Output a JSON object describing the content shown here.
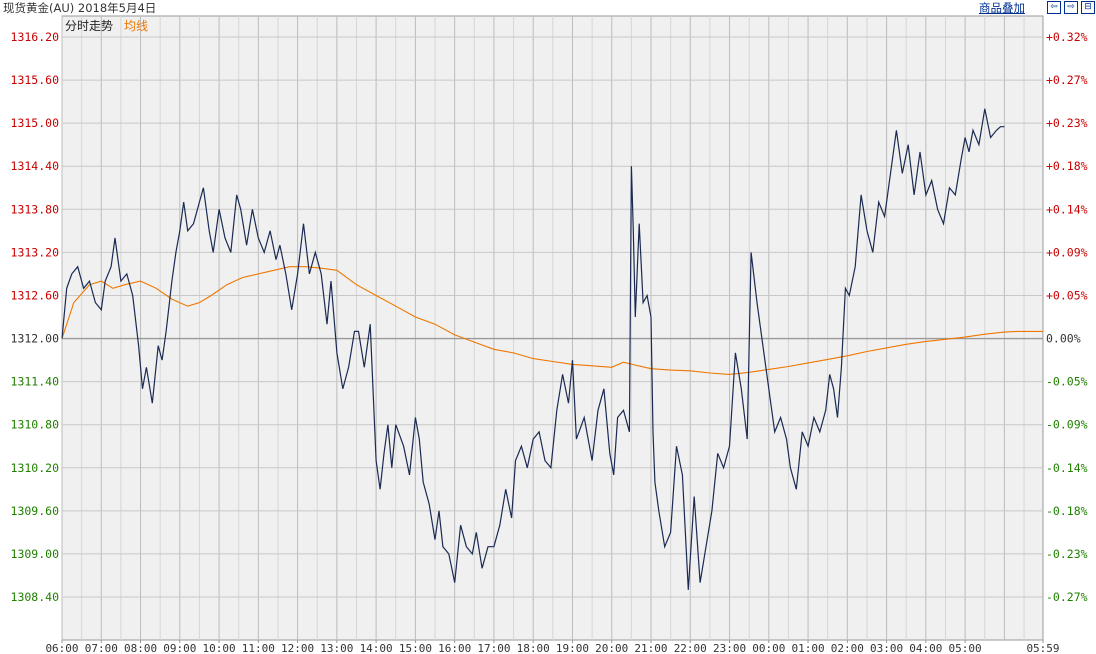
{
  "header": {
    "title": "现货黄金(AU) 2018年5月4日",
    "overlay_link": "商品叠加",
    "buttons": [
      {
        "name": "zoom-left-button",
        "glyph": "⇦"
      },
      {
        "name": "zoom-right-button",
        "glyph": "⇨"
      },
      {
        "name": "layout-button",
        "glyph": "⊟"
      }
    ]
  },
  "colors": {
    "background": "#f0f0f0",
    "grid": "#c8c8c8",
    "price_line": "#1a2a52",
    "avg_line": "#ee7700",
    "up": "#c80000",
    "down": "#208000",
    "neutral": "#333333"
  },
  "chart_data": {
    "type": "line",
    "legend": [
      "分时走势",
      "均线"
    ],
    "reference_price": 1312.0,
    "ylim": [
      1308.0,
      1316.3
    ],
    "y_ticks": [
      "1316.20",
      "1315.60",
      "1315.00",
      "1314.40",
      "1313.80",
      "1313.20",
      "1312.60",
      "1312.00",
      "1311.40",
      "1310.80",
      "1310.20",
      "1309.60",
      "1309.00",
      "1308.40"
    ],
    "right_ticks": [
      "+0.32%",
      "+0.27%",
      "+0.23%",
      "+0.18%",
      "+0.14%",
      "+0.09%",
      "+0.05%",
      "0.00%",
      "-0.05%",
      "-0.09%",
      "-0.14%",
      "-0.18%",
      "-0.23%",
      "-0.27%"
    ],
    "x_ticks": [
      "06:00",
      "07:00",
      "08:00",
      "09:00",
      "10:00",
      "11:00",
      "12:00",
      "13:00",
      "14:00",
      "15:00",
      "16:00",
      "17:00",
      "18:00",
      "19:00",
      "20:00",
      "21:00",
      "22:00",
      "23:00",
      "00:00",
      "01:00",
      "02:00",
      "03:00",
      "04:00",
      "05:00",
      "05:59"
    ],
    "series": [
      {
        "name": "分时走势",
        "x_hours": [
          0,
          0.12,
          0.25,
          0.4,
          0.55,
          0.7,
          0.85,
          1.0,
          1.1,
          1.25,
          1.35,
          1.5,
          1.65,
          1.8,
          1.95,
          2.05,
          2.15,
          2.3,
          2.45,
          2.55,
          2.65,
          2.8,
          2.9,
          3.0,
          3.1,
          3.2,
          3.35,
          3.5,
          3.6,
          3.75,
          3.85,
          4.0,
          4.15,
          4.3,
          4.45,
          4.55,
          4.7,
          4.85,
          5.0,
          5.15,
          5.3,
          5.45,
          5.55,
          5.7,
          5.85,
          6.0,
          6.15,
          6.3,
          6.45,
          6.6,
          6.75,
          6.85,
          7.0,
          7.15,
          7.3,
          7.45,
          7.55,
          7.7,
          7.85,
          8.0,
          8.1,
          8.2,
          8.3,
          8.4,
          8.5,
          8.7,
          8.85,
          9.0,
          9.1,
          9.2,
          9.35,
          9.5,
          9.6,
          9.7,
          9.85,
          10.0,
          10.15,
          10.3,
          10.45,
          10.55,
          10.7,
          10.85,
          11.0,
          11.15,
          11.3,
          11.45,
          11.55,
          11.7,
          11.85,
          12.0,
          12.15,
          12.3,
          12.45,
          12.6,
          12.75,
          12.9,
          13.0,
          13.1,
          13.3,
          13.5,
          13.65,
          13.8,
          13.95,
          14.05,
          14.15,
          14.3,
          14.45,
          14.5,
          14.55,
          14.6,
          14.7,
          14.8,
          14.9,
          15.0,
          15.05,
          15.1,
          15.2,
          15.35,
          15.5,
          15.65,
          15.8,
          15.95,
          16.1,
          16.25,
          16.4,
          16.55,
          16.7,
          16.85,
          17.0,
          17.15,
          17.3,
          17.45,
          17.55,
          17.7,
          17.85,
          18.0,
          18.15,
          18.3,
          18.45,
          18.55,
          18.7,
          18.85,
          19.0,
          19.15,
          19.3,
          19.45,
          19.55,
          19.65,
          19.75,
          19.85,
          19.95,
          20.05,
          20.2,
          20.35,
          20.5,
          20.65,
          20.8,
          20.95,
          21.1,
          21.25,
          21.4,
          21.55,
          21.7,
          21.85,
          22.0,
          22.15,
          22.3,
          22.45,
          22.6,
          22.75,
          22.9,
          23.0,
          23.1,
          23.2,
          23.35,
          23.5,
          23.65,
          23.8,
          23.9,
          24.0,
          24.05,
          24.1,
          24.15,
          24.98
        ],
        "values": [
          1312.0,
          1312.7,
          1312.9,
          1313.0,
          1312.7,
          1312.8,
          1312.5,
          1312.4,
          1312.8,
          1313.0,
          1313.4,
          1312.8,
          1312.9,
          1312.6,
          1311.9,
          1311.3,
          1311.6,
          1311.1,
          1311.9,
          1311.7,
          1312.1,
          1312.8,
          1313.2,
          1313.5,
          1313.9,
          1313.5,
          1313.6,
          1313.9,
          1314.1,
          1313.5,
          1313.2,
          1313.8,
          1313.4,
          1313.2,
          1314.0,
          1313.8,
          1313.3,
          1313.8,
          1313.4,
          1313.2,
          1313.5,
          1313.1,
          1313.3,
          1312.9,
          1312.4,
          1312.9,
          1313.6,
          1312.9,
          1313.2,
          1312.9,
          1312.2,
          1312.8,
          1311.8,
          1311.3,
          1311.6,
          1312.1,
          1312.1,
          1311.6,
          1312.2,
          1310.3,
          1309.9,
          1310.4,
          1310.8,
          1310.2,
          1310.8,
          1310.5,
          1310.1,
          1310.9,
          1310.6,
          1310.0,
          1309.7,
          1309.2,
          1309.6,
          1309.1,
          1309.0,
          1308.6,
          1309.4,
          1309.1,
          1309.0,
          1309.3,
          1308.8,
          1309.1,
          1309.1,
          1309.4,
          1309.9,
          1309.5,
          1310.3,
          1310.5,
          1310.2,
          1310.6,
          1310.7,
          1310.3,
          1310.2,
          1311.0,
          1311.5,
          1311.1,
          1311.7,
          1310.6,
          1310.9,
          1310.3,
          1311.0,
          1311.3,
          1310.4,
          1310.1,
          1310.9,
          1311.0,
          1310.7,
          1314.4,
          1313.5,
          1312.3,
          1313.6,
          1312.5,
          1312.6,
          1312.3,
          1310.7,
          1310.0,
          1309.6,
          1309.1,
          1309.3,
          1310.5,
          1310.1,
          1308.5,
          1309.8,
          1308.6,
          1309.1,
          1309.6,
          1310.4,
          1310.2,
          1310.5,
          1311.8,
          1311.3,
          1310.6,
          1313.2,
          1312.5,
          1311.9,
          1311.3,
          1310.7,
          1310.9,
          1310.6,
          1310.2,
          1309.9,
          1310.7,
          1310.5,
          1310.9,
          1310.7,
          1311.0,
          1311.5,
          1311.3,
          1310.9,
          1311.6,
          1312.7,
          1312.6,
          1313.0,
          1314.0,
          1313.5,
          1313.2,
          1313.9,
          1313.7,
          1314.3,
          1314.9,
          1314.3,
          1314.7,
          1314.0,
          1314.6,
          1314.0,
          1314.2,
          1313.8,
          1313.6,
          1314.1,
          1314.0,
          1314.5,
          1314.8,
          1314.6,
          1314.9,
          1314.7,
          1315.2,
          1314.8,
          1314.9,
          1314.95,
          1314.95
        ]
      },
      {
        "name": "均线",
        "x_hours": [
          0,
          0.3,
          0.7,
          1.0,
          1.3,
          1.6,
          2.0,
          2.4,
          2.8,
          3.2,
          3.5,
          3.8,
          4.2,
          4.6,
          5.0,
          5.4,
          5.8,
          6.2,
          6.6,
          7.0,
          7.5,
          8.0,
          8.5,
          9.0,
          9.5,
          10.0,
          10.5,
          11.0,
          11.5,
          12.0,
          12.5,
          13.0,
          13.5,
          14.0,
          14.3,
          14.6,
          15.0,
          15.5,
          16.0,
          16.5,
          17.0,
          17.5,
          18.0,
          18.5,
          19.0,
          19.5,
          20.0,
          20.5,
          21.0,
          21.5,
          22.0,
          22.5,
          23.0,
          23.5,
          24.0,
          24.3,
          24.98
        ],
        "values": [
          1312.0,
          1312.5,
          1312.75,
          1312.8,
          1312.7,
          1312.75,
          1312.8,
          1312.7,
          1312.55,
          1312.45,
          1312.5,
          1312.6,
          1312.75,
          1312.85,
          1312.9,
          1312.95,
          1313.0,
          1313.0,
          1312.98,
          1312.95,
          1312.75,
          1312.6,
          1312.45,
          1312.3,
          1312.2,
          1312.05,
          1311.95,
          1311.85,
          1311.8,
          1311.72,
          1311.68,
          1311.64,
          1311.62,
          1311.6,
          1311.67,
          1311.63,
          1311.58,
          1311.56,
          1311.55,
          1311.52,
          1311.5,
          1311.53,
          1311.57,
          1311.61,
          1311.66,
          1311.71,
          1311.76,
          1311.82,
          1311.87,
          1311.92,
          1311.96,
          1311.99,
          1312.02,
          1312.06,
          1312.09,
          1312.1,
          1312.1
        ]
      }
    ]
  }
}
